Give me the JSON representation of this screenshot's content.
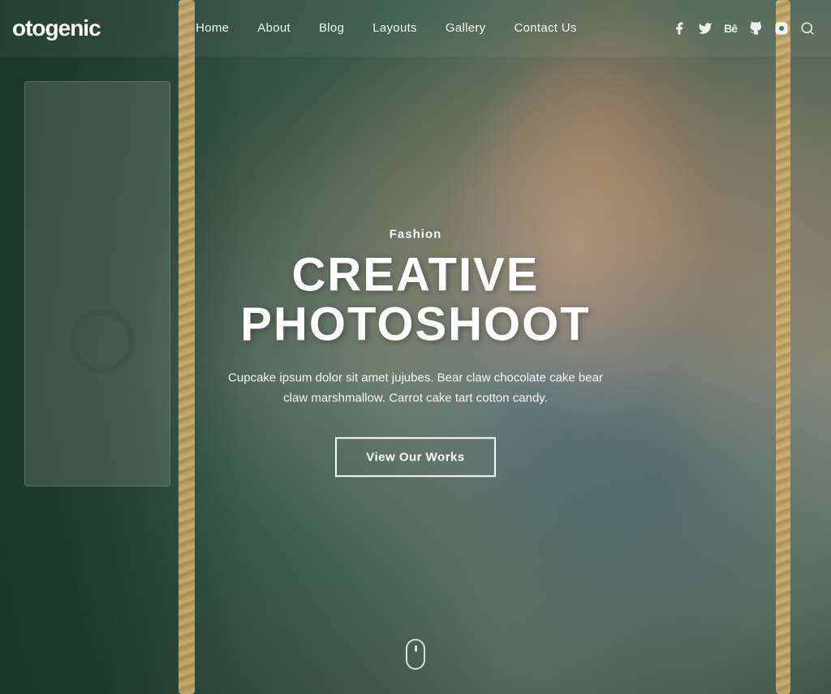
{
  "site": {
    "logo": "otogenic",
    "logo_partial": "otogenic"
  },
  "navbar": {
    "links": [
      {
        "label": "Home",
        "href": "#"
      },
      {
        "label": "About",
        "href": "#"
      },
      {
        "label": "Blog",
        "href": "#"
      },
      {
        "label": "Layouts",
        "href": "#"
      },
      {
        "label": "Gallery",
        "href": "#"
      },
      {
        "label": "Contact Us",
        "href": "#"
      }
    ],
    "social": [
      {
        "name": "facebook-icon",
        "symbol": "f"
      },
      {
        "name": "twitter-icon",
        "symbol": "t"
      },
      {
        "name": "behance-icon",
        "symbol": "be"
      },
      {
        "name": "github-icon",
        "symbol": "gh"
      },
      {
        "name": "instagram-icon",
        "symbol": "ig"
      },
      {
        "name": "search-icon",
        "symbol": "s"
      }
    ]
  },
  "hero": {
    "category": "Fashion",
    "title": "CREATIVE PHOTOSHOOT",
    "description": "Cupcake ipsum dolor sit amet jujubes. Bear claw chocolate cake bear claw marshmallow. Carrot cake tart cotton candy.",
    "button_label": "View Our Works",
    "accent_color": "#ffffff"
  }
}
